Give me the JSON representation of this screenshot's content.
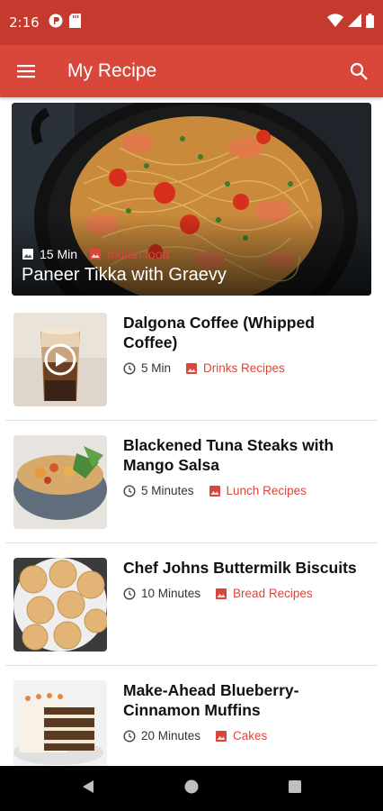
{
  "status_bar": {
    "time": "2:16",
    "icons": [
      "podcast-notification-icon",
      "sd-card-icon",
      "wifi-icon",
      "cell-signal-icon",
      "battery-icon"
    ]
  },
  "app_bar": {
    "title": "My Recipe",
    "menu_icon": "hamburger-menu-icon",
    "search_icon": "search-icon"
  },
  "featured": {
    "time": "15 Min",
    "category": "Indian food",
    "title": "Paneer Tikka with Graevy"
  },
  "recipes": [
    {
      "title": "Dalgona Coffee (Whipped Coffee)",
      "time": "5 Min",
      "category": "Drinks Recipes",
      "has_video": true
    },
    {
      "title": "Blackened Tuna Steaks with Mango Salsa",
      "time": "5 Minutes",
      "category": "Lunch Recipes",
      "has_video": false
    },
    {
      "title": "Chef Johns Buttermilk Biscuits",
      "time": "10 Minutes",
      "category": "Bread Recipes",
      "has_video": false
    },
    {
      "title": "Make-Ahead Blueberry-Cinnamon Muffins",
      "time": "20 Minutes",
      "category": "Cakes",
      "has_video": false
    }
  ],
  "colors": {
    "status_bar": "#c43a2f",
    "app_bar": "#d9473b",
    "accent": "#d9473b",
    "nav_bar": "#000000"
  },
  "nav": {
    "back_icon": "back-icon",
    "home_icon": "home-icon",
    "recents_icon": "recents-icon"
  }
}
